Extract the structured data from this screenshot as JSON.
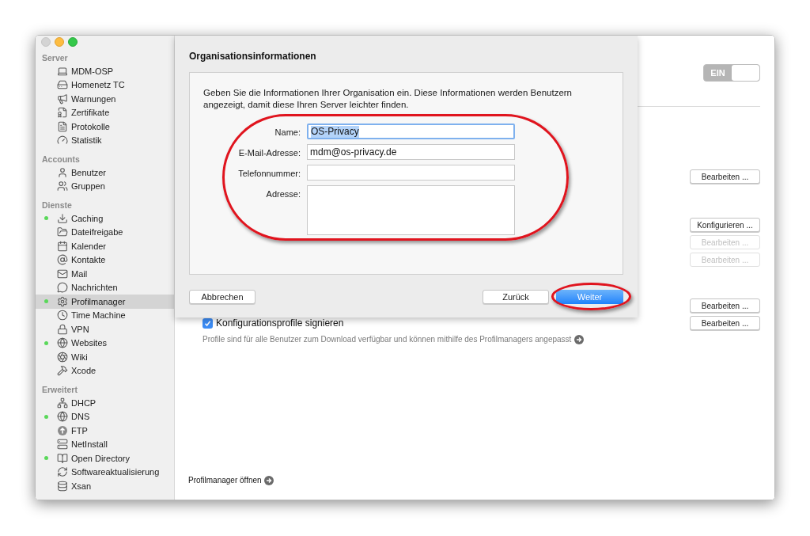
{
  "sidebar": {
    "sections": [
      {
        "title": "Server",
        "items": [
          {
            "label": "MDM-OSP",
            "running": false,
            "selected": false
          },
          {
            "label": "Homenetz TC",
            "running": false,
            "selected": false
          },
          {
            "label": "Warnungen",
            "running": false,
            "selected": false
          },
          {
            "label": "Zertifikate",
            "running": false,
            "selected": false
          },
          {
            "label": "Protokolle",
            "running": false,
            "selected": false
          },
          {
            "label": "Statistik",
            "running": false,
            "selected": false
          }
        ]
      },
      {
        "title": "Accounts",
        "items": [
          {
            "label": "Benutzer",
            "running": false,
            "selected": false
          },
          {
            "label": "Gruppen",
            "running": false,
            "selected": false
          }
        ]
      },
      {
        "title": "Dienste",
        "items": [
          {
            "label": "Caching",
            "running": true,
            "selected": false
          },
          {
            "label": "Dateifreigabe",
            "running": false,
            "selected": false
          },
          {
            "label": "Kalender",
            "running": false,
            "selected": false
          },
          {
            "label": "Kontakte",
            "running": false,
            "selected": false
          },
          {
            "label": "Mail",
            "running": false,
            "selected": false
          },
          {
            "label": "Nachrichten",
            "running": false,
            "selected": false
          },
          {
            "label": "Profilmanager",
            "running": true,
            "selected": true
          },
          {
            "label": "Time Machine",
            "running": false,
            "selected": false
          },
          {
            "label": "VPN",
            "running": false,
            "selected": false
          },
          {
            "label": "Websites",
            "running": true,
            "selected": false
          },
          {
            "label": "Wiki",
            "running": false,
            "selected": false
          },
          {
            "label": "Xcode",
            "running": false,
            "selected": false
          }
        ]
      },
      {
        "title": "Erweitert",
        "items": [
          {
            "label": "DHCP",
            "running": false,
            "selected": false
          },
          {
            "label": "DNS",
            "running": true,
            "selected": false
          },
          {
            "label": "FTP",
            "running": false,
            "selected": false
          },
          {
            "label": "NetInstall",
            "running": false,
            "selected": false
          },
          {
            "label": "Open Directory",
            "running": true,
            "selected": false
          },
          {
            "label": "Softwareaktualisierung",
            "running": false,
            "selected": false
          },
          {
            "label": "Xsan",
            "running": false,
            "selected": false
          }
        ]
      }
    ]
  },
  "main": {
    "service_toggle": {
      "label": "EIN",
      "on": true
    },
    "button_groups": [
      [
        {
          "label": "Bearbeiten ...",
          "disabled": false
        }
      ],
      [
        {
          "label": "Konfigurieren ...",
          "disabled": false
        },
        {
          "label": "Bearbeiten ...",
          "disabled": true
        },
        {
          "label": "Bearbeiten ...",
          "disabled": true
        }
      ],
      [
        {
          "label": "Bearbeiten ...",
          "disabled": false
        },
        {
          "label": "Bearbeiten ...",
          "disabled": false
        }
      ]
    ],
    "sign_profiles": {
      "label": "Konfigurationsprofile signieren",
      "checked": true
    },
    "help_text": "Profile sind für alle Benutzer zum Download verfügbar und können mithilfe des Profilmanagers angepasst",
    "open_link": "Profilmanager öffnen"
  },
  "sheet": {
    "title": "Organisationsinformationen",
    "description": "Geben Sie die Informationen Ihrer Organisation ein. Diese Informationen werden Benutzern angezeigt, damit diese Ihren Server leichter finden.",
    "fields": [
      {
        "kind": "line",
        "label": "Name:",
        "value": "OS-Privacy",
        "focused": true
      },
      {
        "kind": "line",
        "label": "E-Mail-Adresse:",
        "value": "mdm@os-privacy.de",
        "focused": false
      },
      {
        "kind": "line",
        "label": "Telefonnummer:",
        "focused": false
      },
      {
        "kind": "area",
        "label": "Adresse:",
        "focused": false
      }
    ],
    "buttons": {
      "cancel": "Abbrechen",
      "back": "Zurück",
      "next": "Weiter"
    }
  }
}
